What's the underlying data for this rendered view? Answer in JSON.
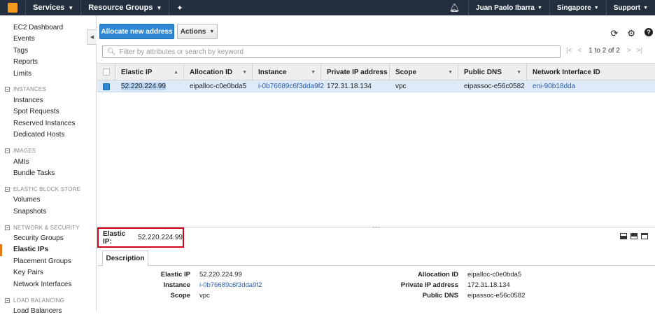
{
  "topnav": {
    "services": "Services",
    "resource_groups": "Resource Groups",
    "user": "Juan Paolo Ibarra",
    "region": "Singapore",
    "support": "Support"
  },
  "sidebar": {
    "items": [
      {
        "type": "link",
        "label": "EC2 Dashboard"
      },
      {
        "type": "link",
        "label": "Events"
      },
      {
        "type": "link",
        "label": "Tags"
      },
      {
        "type": "link",
        "label": "Reports"
      },
      {
        "type": "link",
        "label": "Limits"
      },
      {
        "type": "section",
        "label": "INSTANCES"
      },
      {
        "type": "link",
        "label": "Instances"
      },
      {
        "type": "link",
        "label": "Spot Requests"
      },
      {
        "type": "link",
        "label": "Reserved Instances"
      },
      {
        "type": "link",
        "label": "Dedicated Hosts"
      },
      {
        "type": "section",
        "label": "IMAGES"
      },
      {
        "type": "link",
        "label": "AMIs"
      },
      {
        "type": "link",
        "label": "Bundle Tasks"
      },
      {
        "type": "section",
        "label": "ELASTIC BLOCK STORE"
      },
      {
        "type": "link",
        "label": "Volumes"
      },
      {
        "type": "link",
        "label": "Snapshots"
      },
      {
        "type": "section",
        "label": "NETWORK & SECURITY"
      },
      {
        "type": "link",
        "label": "Security Groups"
      },
      {
        "type": "link",
        "label": "Elastic IPs",
        "active": true
      },
      {
        "type": "link",
        "label": "Placement Groups"
      },
      {
        "type": "link",
        "label": "Key Pairs"
      },
      {
        "type": "link",
        "label": "Network Interfaces"
      },
      {
        "type": "section",
        "label": "LOAD BALANCING"
      },
      {
        "type": "link",
        "label": "Load Balancers"
      }
    ]
  },
  "toolbar": {
    "allocate_label": "Allocate new address",
    "actions_label": "Actions"
  },
  "search": {
    "placeholder": "Filter by attributes or search by keyword",
    "value": ""
  },
  "pager": {
    "count": "1 to 2 of 2"
  },
  "table": {
    "columns": [
      "Elastic IP",
      "Allocation ID",
      "Instance",
      "Private IP address",
      "Scope",
      "Public DNS",
      "Network Interface ID"
    ],
    "rows": [
      {
        "elastic_ip": "52.220.224.99",
        "allocation_id": "eipalloc-c0e0bda5",
        "instance": "i-0b76689c6f3dda9f2",
        "private_ip": "172.31.18.134",
        "scope": "vpc",
        "public_dns": "eipassoc-e56c0582",
        "eni": "eni-90b18dda"
      }
    ]
  },
  "detail": {
    "title_label": "Elastic IP:",
    "title_value": "52.220.224.99",
    "tab": "Description",
    "left": [
      {
        "key": "Elastic IP",
        "value": "52.220.224.99",
        "link": false
      },
      {
        "key": "Instance",
        "value": "i-0b76689c6f3dda9f2",
        "link": true
      },
      {
        "key": "Scope",
        "value": "vpc",
        "link": false
      }
    ],
    "right": [
      {
        "key": "Allocation ID",
        "value": "eipalloc-c0e0bda5"
      },
      {
        "key": "Private IP address",
        "value": "172.31.18.134"
      },
      {
        "key": "Public DNS",
        "value": "eipassoc-e56c0582"
      }
    ]
  },
  "colors": {
    "nav_bg": "#232f3e",
    "primary_button": "#2d87d2",
    "selected_row": "#dfeaf8",
    "highlight_box": "#d0021b",
    "active_marker": "#e47911"
  }
}
